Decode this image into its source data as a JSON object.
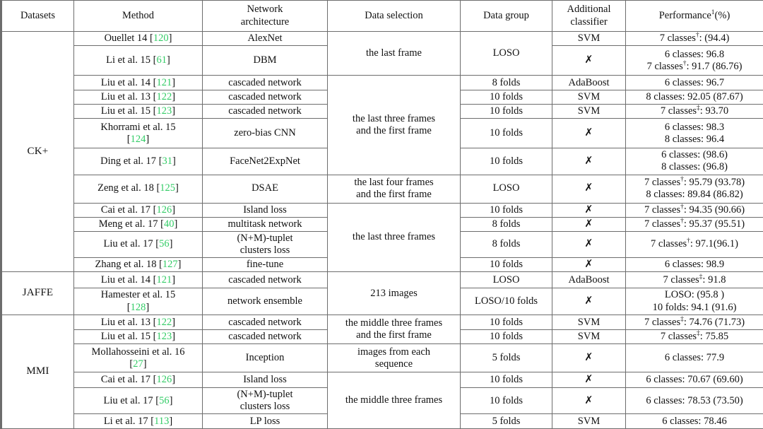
{
  "table": {
    "headers": [
      "Datasets",
      "Method",
      "Network architecture",
      "Data selection",
      "Data group",
      "Additional classifier",
      "Performance"
    ],
    "header_network_l1": "Network",
    "header_network_l2": "architecture",
    "header_addcls_l1": "Additional",
    "header_addcls_l2": "classifier",
    "header_perf_base": "Performance",
    "header_perf_sup": "1",
    "header_perf_unit": "(%)",
    "cross_mark": "✗",
    "dagger": "†",
    "ddagger": "‡",
    "citation_color": "#33cc66",
    "rule_color": "#6d6d6d"
  },
  "chart_data": {
    "type": "table",
    "title": "Comparison of deep-learning facial expression recognition methods on CK+, JAFFE and MMI",
    "columns": [
      "Datasets",
      "Method",
      "Network architecture",
      "Data selection",
      "Data group",
      "Additional classifier",
      "Performance (%)"
    ],
    "rows": [
      {
        "dataset": "CK+",
        "method": "Ouellet 14",
        "ref": "120",
        "arch": "AlexNet",
        "selection": "the last frame",
        "group": "LOSO",
        "classifier": "SVM",
        "performance": [
          "7 classes†: (94.4)"
        ]
      },
      {
        "dataset": "CK+",
        "method": "Li et al. 15",
        "ref": "61",
        "arch": "DBM",
        "selection": "the last frame",
        "group": "LOSO",
        "classifier": "✗",
        "performance": [
          "6 classes: 96.8",
          "7 classes†: 91.7 (86.76)"
        ]
      },
      {
        "dataset": "CK+",
        "method": "Liu et al. 14",
        "ref": "121",
        "arch": "cascaded network",
        "selection": "the last three frames and the first frame",
        "group": "8 folds",
        "classifier": "AdaBoost",
        "performance": [
          "6 classes: 96.7"
        ]
      },
      {
        "dataset": "CK+",
        "method": "Liu et al. 13",
        "ref": "122",
        "arch": "cascaded network",
        "selection": "the last three frames and the first frame",
        "group": "10 folds",
        "classifier": "SVM",
        "performance": [
          "8 classes: 92.05 (87.67)"
        ]
      },
      {
        "dataset": "CK+",
        "method": "Liu et al. 15",
        "ref": "123",
        "arch": "cascaded network",
        "selection": "the last three frames and the first frame",
        "group": "10 folds",
        "classifier": "SVM",
        "performance": [
          "7 classes‡: 93.70"
        ]
      },
      {
        "dataset": "CK+",
        "method": "Khorrami et al. 15",
        "ref": "124",
        "arch": "zero-bias CNN",
        "selection": "the last three frames and the first frame",
        "group": "10 folds",
        "classifier": "✗",
        "performance": [
          "6 classes: 98.3",
          "8 classes: 96.4"
        ]
      },
      {
        "dataset": "CK+",
        "method": "Ding et al. 17",
        "ref": "31",
        "arch": "FaceNet2ExpNet",
        "selection": "the last three frames and the first frame",
        "group": "10 folds",
        "classifier": "✗",
        "performance": [
          "6 classes: (98.6)",
          "8 classes: (96.8)"
        ]
      },
      {
        "dataset": "CK+",
        "method": "Zeng et al. 18",
        "ref": "125",
        "arch": "DSAE",
        "selection": "the last four frames and the first frame",
        "group": "LOSO",
        "classifier": "✗",
        "performance": [
          "7 classes†: 95.79 (93.78)",
          "8 classes: 89.84 (86.82)"
        ]
      },
      {
        "dataset": "CK+",
        "method": "Cai et al. 17",
        "ref": "126",
        "arch": "Island loss",
        "selection": "the last three frames",
        "group": "10 folds",
        "classifier": "✗",
        "performance": [
          "7 classes†: 94.35 (90.66)"
        ]
      },
      {
        "dataset": "CK+",
        "method": "Meng et al. 17",
        "ref": "40",
        "arch": "multitask network",
        "selection": "the last three frames",
        "group": "8 folds",
        "classifier": "✗",
        "performance": [
          "7 classes†: 95.37 (95.51)"
        ]
      },
      {
        "dataset": "CK+",
        "method": "Liu et al. 17",
        "ref": "56",
        "arch": "(N+M)-tuplet clusters loss",
        "selection": "the last three frames",
        "group": "8 folds",
        "classifier": "✗",
        "performance": [
          "7 classes†: 97.1(96.1)"
        ]
      },
      {
        "dataset": "CK+",
        "method": "Zhang et al. 18",
        "ref": "127",
        "arch": "fine-tune",
        "selection": "the last three frames",
        "group": "10 folds",
        "classifier": "✗",
        "performance": [
          "6 classes: 98.9"
        ]
      },
      {
        "dataset": "JAFFE",
        "method": "Liu et al. 14",
        "ref": "121",
        "arch": "cascaded network",
        "selection": "213 images",
        "group": "LOSO",
        "classifier": "AdaBoost",
        "performance": [
          "7 classes‡: 91.8"
        ]
      },
      {
        "dataset": "JAFFE",
        "method": "Hamester et al. 15",
        "ref": "128",
        "arch": "network ensemble",
        "selection": "213 images",
        "group": "LOSO/10 folds",
        "classifier": "✗",
        "performance": [
          "LOSO: (95.8 )",
          "10 folds: 94.1 (91.6)"
        ]
      },
      {
        "dataset": "MMI",
        "method": "Liu et al. 13",
        "ref": "122",
        "arch": "cascaded network",
        "selection": "the middle three frames and the first frame",
        "group": "10 folds",
        "classifier": "SVM",
        "performance": [
          "7 classes‡: 74.76 (71.73)"
        ]
      },
      {
        "dataset": "MMI",
        "method": "Liu et al. 15",
        "ref": "123",
        "arch": "cascaded network",
        "selection": "the middle three frames and the first frame",
        "group": "10 folds",
        "classifier": "SVM",
        "performance": [
          "7 classes‡: 75.85"
        ]
      },
      {
        "dataset": "MMI",
        "method": "Mollahosseini et al. 16",
        "ref": "27",
        "arch": "Inception",
        "selection": "images from each sequence",
        "group": "5 folds",
        "classifier": "✗",
        "performance": [
          "6 classes: 77.9"
        ]
      },
      {
        "dataset": "MMI",
        "method": "Cai et al. 17",
        "ref": "126",
        "arch": "Island loss",
        "selection": "the middle three frames",
        "group": "10 folds",
        "classifier": "✗",
        "performance": [
          "6 classes: 70.67 (69.60)"
        ]
      },
      {
        "dataset": "MMI",
        "method": "Liu et al. 17",
        "ref": "56",
        "arch": "(N+M)-tuplet clusters loss",
        "selection": "the middle three frames",
        "group": "10 folds",
        "classifier": "✗",
        "performance": [
          "6 classes: 78.53 (73.50)"
        ]
      },
      {
        "dataset": "MMI",
        "method": "Li et al. 17",
        "ref": "113",
        "arch": "LP loss",
        "selection": "the middle three frames",
        "group": "5 folds",
        "classifier": "SVM",
        "performance": [
          "6 classes: 78.46"
        ]
      }
    ]
  },
  "datasets": {
    "ckplus": "CK+",
    "jaffe": "JAFFE",
    "mmi": "MMI"
  },
  "methods": {
    "ouellet14": "Ouellet 14",
    "li15": "Li et al. 15",
    "liu14": "Liu et al. 14",
    "liu13": "Liu et al. 13",
    "liu15": "Liu et al. 15",
    "khorrami15_l1": "Khorrami et al. 15",
    "ding17": "Ding et al. 17",
    "zeng18": "Zeng et al. 18",
    "cai17": "Cai et al. 17",
    "meng17": "Meng et al. 17",
    "liu17": "Liu et al. 17",
    "zhang18": "Zhang et al. 18",
    "hamester15_l1": "Hamester et al. 15",
    "mollahosseini16_l1": "Mollahosseini et al. 16",
    "li17": "Li et al. 17"
  },
  "refs": {
    "r120": "120",
    "r61": "61",
    "r121": "121",
    "r122": "122",
    "r123": "123",
    "r124": "124",
    "r31": "31",
    "r125": "125",
    "r126": "126",
    "r40": "40",
    "r56": "56",
    "r127": "127",
    "r128": "128",
    "r27": "27",
    "r113": "113",
    "open": "[",
    "close": "]"
  },
  "architectures": {
    "alexnet": "AlexNet",
    "dbm": "DBM",
    "cascaded": "cascaded network",
    "zerobias": "zero-bias CNN",
    "facenet2expnet": "FaceNet2ExpNet",
    "dsae": "DSAE",
    "island": "Island loss",
    "multitask": "multitask network",
    "tuplet_l1": "(N+M)-tuplet",
    "tuplet_l2": "clusters loss",
    "finetune": "fine-tune",
    "ensemble": "network ensemble",
    "inception": "Inception",
    "lploss": "LP loss"
  },
  "selections": {
    "last_frame": "the last frame",
    "last3_first_l1": "the last three frames",
    "last3_first_l2": "and the first frame",
    "last4_first_l1": "the last four frames",
    "last4_first_l2": "and the first frame",
    "last3": "the last three frames",
    "images213": "213 images",
    "mid3_first_l1": "the middle three frames",
    "mid3_first_l2": "and the first frame",
    "images_each_l1": "images from each",
    "images_each_l2": "sequence",
    "mid3": "the middle three frames"
  },
  "groups": {
    "loso": "LOSO",
    "f8": "8 folds",
    "f10": "10 folds",
    "f5": "5 folds",
    "loso10": "LOSO/10 folds"
  },
  "classifiers": {
    "svm": "SVM",
    "adaboost": "AdaBoost",
    "none": "✗"
  },
  "performance": {
    "p1": "7 classes",
    "p1_rest": ": (94.4)",
    "p2a": "6 classes: 96.8",
    "p2b_pre": "7 classes",
    "p2b_rest": ": 91.7 (86.76)",
    "p3": "6 classes: 96.7",
    "p4": "8 classes: 92.05 (87.67)",
    "p5_pre": "7 classes",
    "p5_rest": ": 93.70",
    "p6a": "6 classes: 98.3",
    "p6b": "8 classes: 96.4",
    "p7a": "6 classes: (98.6)",
    "p7b": "8 classes: (96.8)",
    "p8a_pre": "7 classes",
    "p8a_rest": ": 95.79 (93.78)",
    "p8b": "8 classes: 89.84 (86.82)",
    "p9_pre": "7 classes",
    "p9_rest": ": 94.35 (90.66)",
    "p10_pre": "7 classes",
    "p10_rest": ": 95.37 (95.51)",
    "p11_pre": "7 classes",
    "p11_rest": ": 97.1(96.1)",
    "p12": "6 classes: 98.9",
    "p13_pre": "7 classes",
    "p13_rest": ": 91.8",
    "p14a": "LOSO: (95.8 )",
    "p14b": "10 folds: 94.1 (91.6)",
    "p15_pre": "7 classes",
    "p15_rest": ": 74.76 (71.73)",
    "p16_pre": "7 classes",
    "p16_rest": ": 75.85",
    "p17": "6 classes: 77.9",
    "p18": "6 classes: 70.67 (69.60)",
    "p19": "6 classes: 78.53 (73.50)",
    "p20": "6 classes: 78.46"
  }
}
